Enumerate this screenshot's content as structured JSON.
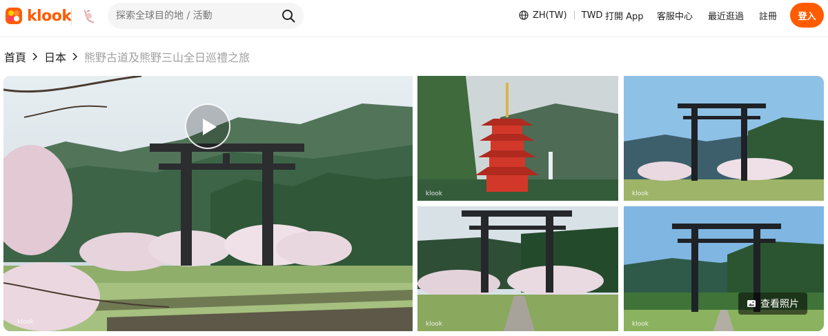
{
  "header": {
    "logo_text": "klook",
    "search_placeholder": "探索全球目的地 / 活動",
    "language": "ZH(TW)",
    "currency": "TWD",
    "open_app": "打開 App",
    "help_center": "客服中心",
    "recently_viewed": "最近逛過",
    "sign_up": "註冊",
    "login": "登入",
    "brand_color": "#ff5b00"
  },
  "breadcrumb": {
    "items": [
      "首頁",
      "日本",
      "熊野古道及熊野三山全日巡禮之旅"
    ]
  },
  "gallery": {
    "watermark": "klook",
    "view_photos": "查看照片",
    "icons": [
      "play-icon",
      "photo-icon"
    ]
  }
}
